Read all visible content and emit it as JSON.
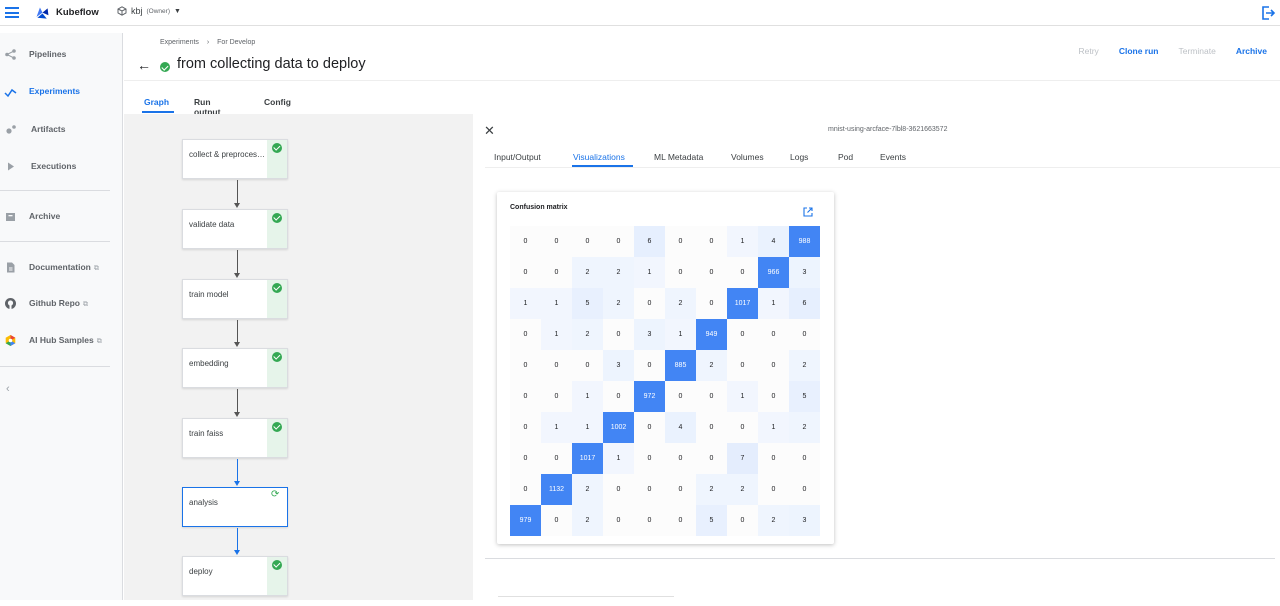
{
  "app": {
    "brand": "Kubeflow",
    "namespace": "kbj",
    "namespace_role": "(Owner)"
  },
  "sidebar": {
    "items": [
      {
        "label": "Pipelines",
        "icon": "pipelines-icon"
      },
      {
        "label": "Experiments",
        "icon": "experiments-icon",
        "active": true
      },
      {
        "label": "Artifacts",
        "icon": "artifacts-icon"
      },
      {
        "label": "Executions",
        "icon": "executions-icon"
      },
      {
        "label": "Archive",
        "icon": "archive-icon"
      },
      {
        "label": "Documentation",
        "icon": "documentation-icon",
        "external": "⧉"
      },
      {
        "label": "Github Repo",
        "icon": "github-icon",
        "external": "⧉"
      },
      {
        "label": "AI Hub Samples",
        "icon": "aihub-icon",
        "external": "⧉"
      }
    ],
    "collapse": "‹"
  },
  "breadcrumb": {
    "root": "Experiments",
    "sep": "›",
    "current": "For Develop"
  },
  "run": {
    "title": "from collecting data to deploy"
  },
  "actions": {
    "retry": "Retry",
    "clone": "Clone run",
    "terminate": "Terminate",
    "archive": "Archive"
  },
  "tabs": {
    "graph": "Graph",
    "run_output": "Run output",
    "config": "Config"
  },
  "graph": {
    "nodes": [
      {
        "label": "collect & preprocess data",
        "status": "succeeded"
      },
      {
        "label": "validate data",
        "status": "succeeded"
      },
      {
        "label": "train model",
        "status": "succeeded"
      },
      {
        "label": "embedding",
        "status": "succeeded"
      },
      {
        "label": "train faiss",
        "status": "succeeded"
      },
      {
        "label": "analysis",
        "status": "running"
      },
      {
        "label": "deploy",
        "status": "succeeded"
      }
    ]
  },
  "details": {
    "pod_name": "mnist-using-arcface-7lbl8-3621663572",
    "tabs": [
      "Input/Output",
      "Visualizations",
      "ML Metadata",
      "Volumes",
      "Logs",
      "Pod",
      "Events"
    ],
    "active_tab": "Visualizations"
  },
  "confusion": {
    "title": "Confusion matrix",
    "highlight_color": "#4285f4",
    "rows": [
      [
        0,
        0,
        0,
        0,
        6,
        0,
        0,
        1,
        4,
        988
      ],
      [
        0,
        0,
        2,
        2,
        1,
        0,
        0,
        0,
        966,
        3
      ],
      [
        1,
        1,
        5,
        2,
        0,
        2,
        0,
        1017,
        1,
        6
      ],
      [
        0,
        1,
        2,
        0,
        3,
        1,
        949,
        0,
        0,
        0
      ],
      [
        0,
        0,
        0,
        3,
        0,
        885,
        2,
        0,
        0,
        2
      ],
      [
        0,
        0,
        1,
        0,
        972,
        0,
        0,
        1,
        0,
        5
      ],
      [
        0,
        1,
        1,
        1002,
        0,
        4,
        0,
        0,
        1,
        2
      ],
      [
        0,
        0,
        1017,
        1,
        0,
        0,
        0,
        7,
        0,
        0
      ],
      [
        0,
        1132,
        2,
        0,
        0,
        0,
        2,
        2,
        0,
        0
      ],
      [
        979,
        0,
        2,
        0,
        0,
        0,
        5,
        0,
        2,
        3
      ]
    ]
  }
}
